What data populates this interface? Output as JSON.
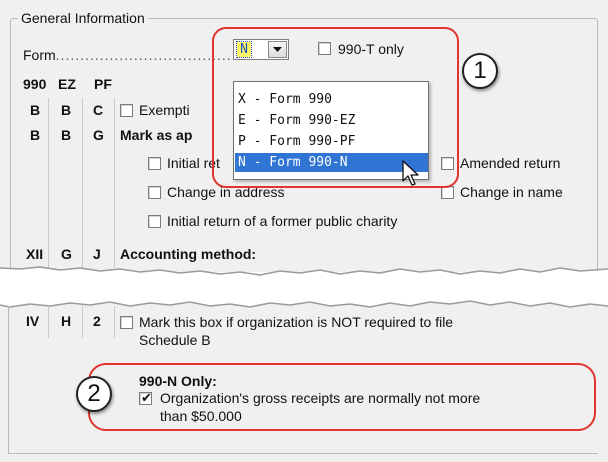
{
  "section_title": "General Information",
  "form": {
    "label": "Form",
    "selected": "N",
    "only_990t_label": "990-T only",
    "options": [
      "X - Form 990",
      "E - Form 990-EZ",
      "P - Form 990-PF",
      "N - Form 990-N"
    ],
    "highlighted_option_index": 3
  },
  "column_headers": [
    "990",
    "EZ",
    "PF"
  ],
  "rows": {
    "exemption": {
      "codes": [
        "B",
        "B",
        "C"
      ],
      "label": "Exempti"
    },
    "mark_as": {
      "codes": [
        "B",
        "B",
        "G"
      ],
      "label": "Mark as ap"
    },
    "initial_return": "Initial ret",
    "amended_return": "Amended return",
    "change_address": "Change in address",
    "change_name": "Change in name",
    "former_public_charity": "Initial return of a former public charity",
    "accounting": {
      "codes": [
        "XII",
        "G",
        "J"
      ],
      "label": "Accounting method:"
    }
  },
  "schedule_b": {
    "codes": [
      "IV",
      "H",
      "2"
    ],
    "line1": "Mark this box if organization is NOT required to file",
    "line2": "Schedule B"
  },
  "n990_only": {
    "title": "990-N Only:",
    "line1": "Organization's gross receipts are normally not more",
    "line2": "than $50.000",
    "checked": true
  },
  "annotations": [
    "1",
    "2"
  ],
  "colors": {
    "panel_bg": "#f0f0f0",
    "annotation_red": "#e0342d",
    "dropdown_highlight": "#3074d4",
    "combo_selected_bg": "#fff36b"
  },
  "icons": [
    "dropdown-arrow-icon",
    "mouse-pointer-icon",
    "checkmark-icon"
  ]
}
